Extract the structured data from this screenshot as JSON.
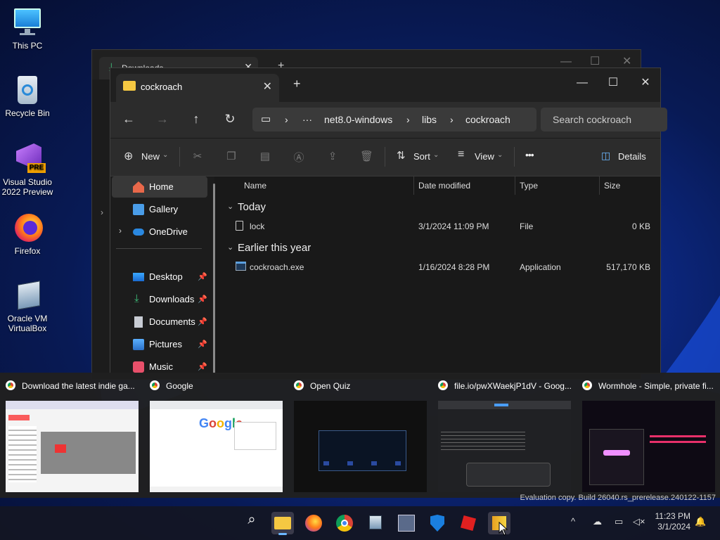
{
  "desktop": {
    "icons": [
      {
        "label": "This PC"
      },
      {
        "label": "Recycle Bin"
      },
      {
        "label": "Visual Studio 2022 Preview",
        "badge": "PRE"
      },
      {
        "label": "Firefox"
      },
      {
        "label": "Oracle VM VirtualBox"
      }
    ]
  },
  "back_window": {
    "tab": "Downloads"
  },
  "explorer": {
    "tab_title": "cockroach",
    "breadcrumb": [
      "net8.0-windows",
      "libs",
      "cockroach"
    ],
    "search_placeholder": "Search cockroach",
    "toolbar": {
      "new": "New",
      "sort": "Sort",
      "view": "View",
      "more": "•••",
      "details": "Details"
    },
    "nav": [
      {
        "label": "Home"
      },
      {
        "label": "Gallery"
      },
      {
        "label": "OneDrive"
      },
      {
        "label": "Desktop"
      },
      {
        "label": "Downloads"
      },
      {
        "label": "Documents"
      },
      {
        "label": "Pictures"
      },
      {
        "label": "Music"
      }
    ],
    "columns": {
      "name": "Name",
      "date": "Date modified",
      "type": "Type",
      "size": "Size"
    },
    "groups": [
      {
        "label": "Today",
        "rows": [
          {
            "name": "lock",
            "date": "3/1/2024 11:09 PM",
            "type": "File",
            "size": "0 KB"
          }
        ]
      },
      {
        "label": "Earlier this year",
        "rows": [
          {
            "name": "cockroach.exe",
            "date": "1/16/2024 8:28 PM",
            "type": "Application",
            "size": "517,170 KB"
          }
        ]
      }
    ]
  },
  "previews": [
    {
      "title": "Download the latest indie ga..."
    },
    {
      "title": "Google"
    },
    {
      "title": "Open Quiz"
    },
    {
      "title": "file.io/pwXWaekjP1dV - Goog..."
    },
    {
      "title": "Wormhole - Simple, private fi..."
    }
  ],
  "watermark": "Evaluation copy. Build 26040.rs_prerelease.240122-1157",
  "clock": {
    "time": "11:23 PM",
    "date": "3/1/2024"
  }
}
